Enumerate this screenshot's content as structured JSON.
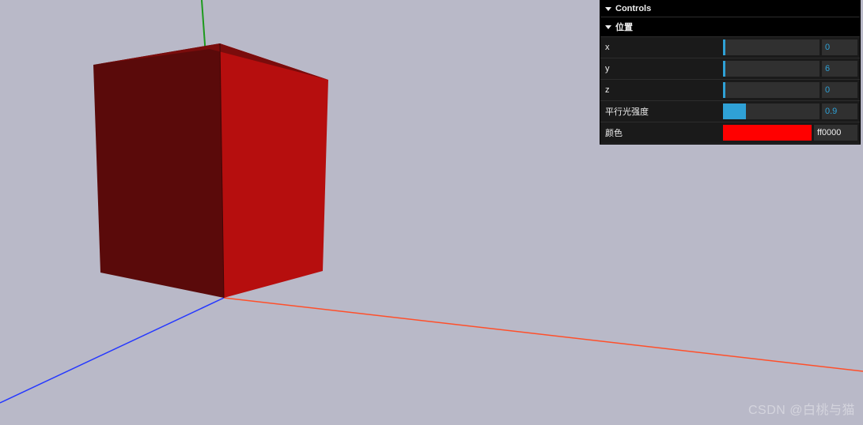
{
  "gui": {
    "title": "Controls",
    "folder_position": {
      "title": "位置",
      "x": {
        "label": "x",
        "value": "0",
        "fill_pct": 0
      },
      "y": {
        "label": "y",
        "value": "6",
        "fill_pct": 0
      },
      "z": {
        "label": "z",
        "value": "0",
        "fill_pct": 0
      }
    },
    "light_intensity": {
      "label": "平行光强度",
      "value": "0.9",
      "fill_pct": 22
    },
    "color": {
      "label": "颜色",
      "swatch": "#ff0000",
      "text": "ff0000"
    }
  },
  "scene": {
    "axes": {
      "x_color": "#ff4f2a",
      "y_color": "#1d9a1d",
      "z_color": "#2538ff"
    },
    "cube": {
      "front_face": "#b60e0e",
      "side_face": "#5a0a0a",
      "top_face": "#7a0c0c"
    },
    "background": "#b9b9c8"
  },
  "watermark": "CSDN @白桃与猫"
}
